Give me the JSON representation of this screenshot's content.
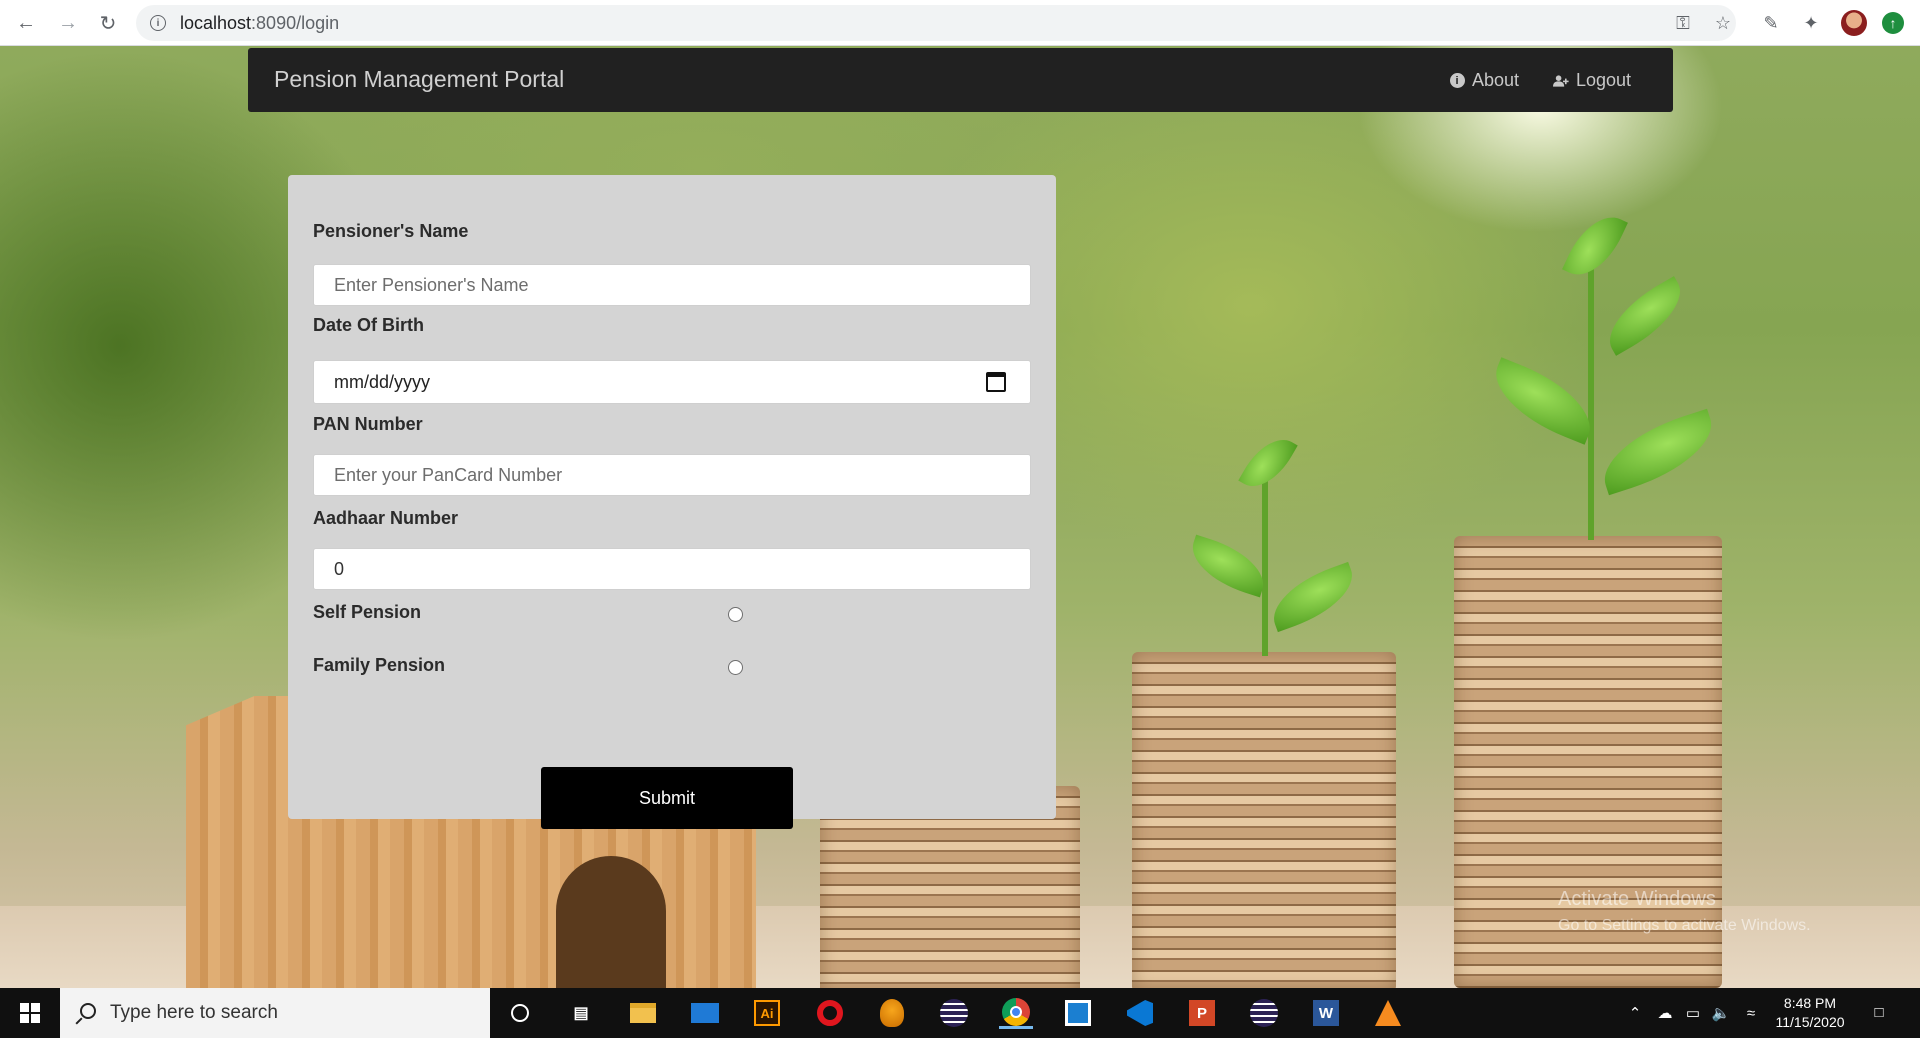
{
  "browser": {
    "url_host": "localhost",
    "url_path": ":8090/login",
    "back_icon": "arrow-left-icon",
    "forward_icon": "arrow-right-icon",
    "reload_icon": "reload-icon"
  },
  "navbar": {
    "brand": "Pension Management Portal",
    "about_label": "About",
    "logout_label": "Logout"
  },
  "form": {
    "name_label": "Pensioner's Name",
    "name_placeholder": "Enter Pensioner's Name",
    "dob_label": "Date Of Birth",
    "dob_value": "mm/dd/yyyy",
    "pan_label": "PAN Number",
    "pan_placeholder": "Enter your PanCard Number",
    "aadhaar_label": "Aadhaar Number",
    "aadhaar_value": "0",
    "self_pension_label": "Self Pension",
    "family_pension_label": "Family Pension",
    "submit_label": "Submit"
  },
  "watermark": {
    "line1": "Activate Windows",
    "line2": "Go to Settings to activate Windows."
  },
  "taskbar": {
    "search_placeholder": "Type here to search",
    "time": "8:48 PM",
    "date": "11/15/2020"
  },
  "colors": {
    "navbar_bg": "#212121",
    "card_bg": "#d4d4d4",
    "submit_bg": "#000000"
  }
}
